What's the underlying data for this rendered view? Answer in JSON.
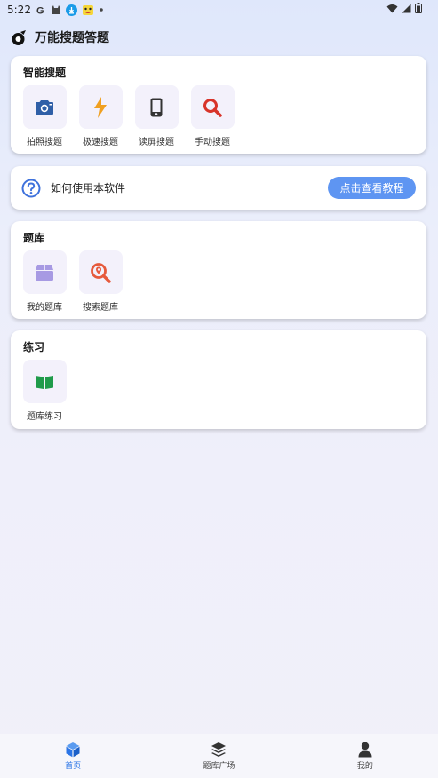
{
  "status_bar": {
    "time": "5:22",
    "icons_left": [
      "google-icon",
      "cat-icon",
      "download-icon",
      "pikachu-icon",
      "dot-icon"
    ],
    "icons_right": [
      "wifi-icon",
      "signal-icon",
      "battery-icon"
    ]
  },
  "header": {
    "title": "万能搜题答题",
    "logo_icon": "app-logo-icon"
  },
  "smart_search": {
    "title": "智能搜题",
    "items": [
      {
        "label": "拍照搜题",
        "icon": "camera-icon",
        "color": "#2f5fa7"
      },
      {
        "label": "极速搜题",
        "icon": "lightning-icon",
        "color": "#f0a020"
      },
      {
        "label": "读屏搜题",
        "icon": "phone-icon",
        "color": "#333333"
      },
      {
        "label": "手动搜题",
        "icon": "magnifier-icon",
        "color": "#d8342a"
      }
    ]
  },
  "help": {
    "text": "如何使用本软件",
    "button_label": "点击查看教程",
    "icon": "question-circle-icon",
    "accent": "#5e95f2"
  },
  "question_bank": {
    "title": "题库",
    "items": [
      {
        "label": "我的题库",
        "icon": "box-icon",
        "color": "#a79ae3"
      },
      {
        "label": "搜索题库",
        "icon": "location-search-icon",
        "color": "#e65a3c"
      }
    ]
  },
  "practice": {
    "title": "练习",
    "items": [
      {
        "label": "题库练习",
        "icon": "book-icon",
        "color": "#1f9b4a"
      }
    ]
  },
  "bottom_nav": {
    "items": [
      {
        "label": "首页",
        "icon": "cube-icon",
        "active": true
      },
      {
        "label": "题库广场",
        "icon": "layers-icon",
        "active": false
      },
      {
        "label": "我的",
        "icon": "person-icon",
        "active": false
      }
    ]
  }
}
